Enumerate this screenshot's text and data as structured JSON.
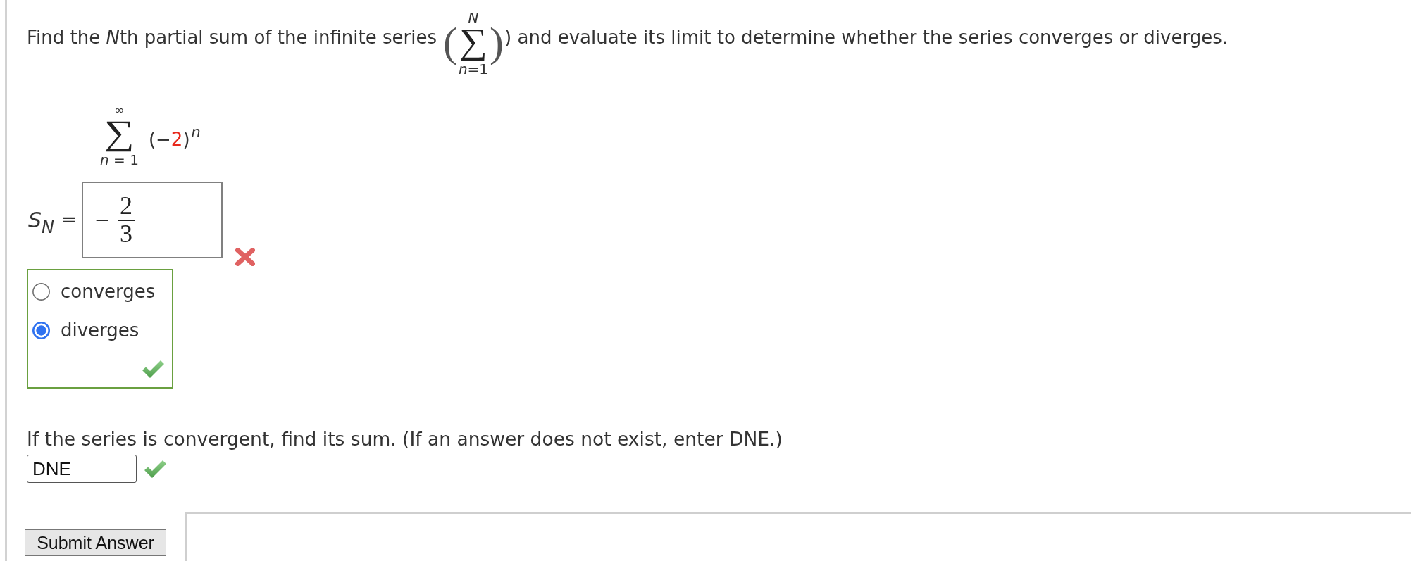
{
  "question": {
    "text_before": [
      {
        "text": "Find the ",
        "italic": false
      },
      {
        "text": "N",
        "italic": true
      },
      {
        "text": "th partial sum of the infinite series",
        "italic": false
      }
    ],
    "notation": {
      "open": "(",
      "upper": "N",
      "symbol": "∑",
      "lower": "*n*=1",
      "close": ")"
    },
    "text_after": ") and evaluate its limit to determine whether the series converges or diverges."
  },
  "series": {
    "upper": "∞",
    "symbol": "∑",
    "lower": "*n* = 1",
    "term": [
      {
        "text": "(−"
      },
      {
        "text": "2",
        "color": "#e8291c"
      },
      {
        "text": ")"
      }
    ],
    "exponent": "n"
  },
  "partial_sum": {
    "label": "S$_{N}$",
    "equals": "=",
    "answer": {
      "sign": "−",
      "numerator": "2",
      "denominator": "3"
    },
    "correct": false
  },
  "convergence": {
    "options": [
      {
        "label": "converges",
        "selected": false
      },
      {
        "label": "diverges",
        "selected": true
      }
    ],
    "correct": true
  },
  "sum_question": {
    "text": "If the series is convergent, find its sum. (If an answer does not exist, enter DNE.)",
    "value": "DNE",
    "correct": true
  },
  "submit_button": "Submit Answer"
}
